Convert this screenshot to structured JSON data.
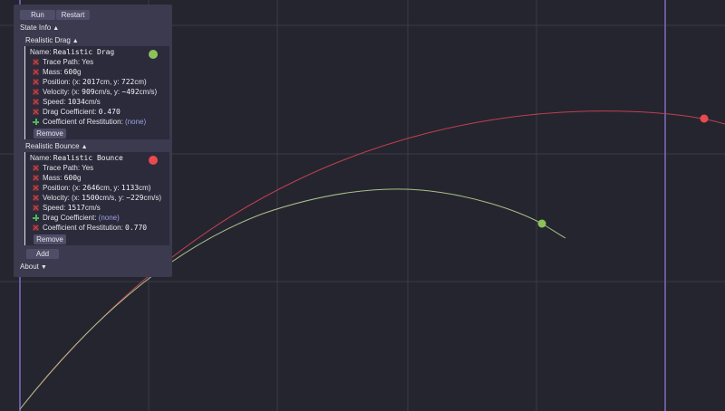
{
  "controls": {
    "run_label": "Run",
    "restart_label": "Restart",
    "add_label": "Add"
  },
  "state_info": {
    "label": "State Info",
    "toggle": "▲"
  },
  "about": {
    "label": "About",
    "toggle": "▼"
  },
  "bodies": [
    {
      "header": "Realistic Drag",
      "toggle": "▲",
      "color": "#e84a4f",
      "name_label": "Name:",
      "name": "Realistic Drag",
      "trace_path": "Trace Path: Yes",
      "mass_label": "Mass:",
      "mass": "600",
      "mass_unit": "g",
      "pos_label": "Position: (x:",
      "pos_x": "2017",
      "pos_mid": "cm, y:",
      "pos_y": "722",
      "pos_end": "cm)",
      "vel_label": "Velocity: (x:",
      "vel_x": "909",
      "vel_mid": "cm/s, y:",
      "vel_y": "−492",
      "vel_end": "cm/s)",
      "speed_label": "Speed:",
      "speed": "1034",
      "speed_unit": "cm/s",
      "drag_label": "Drag Coefficient:",
      "drag": "0.470",
      "rest_label": "Coefficient of Restitution:",
      "rest": "(none)",
      "remove_label": "Remove"
    },
    {
      "header": "Realistic Bounce",
      "toggle": "▲",
      "color": "#8cc25a",
      "name_label": "Name:",
      "name": "Realistic Bounce",
      "trace_path": "Trace Path: Yes",
      "mass_label": "Mass:",
      "mass": "600",
      "mass_unit": "g",
      "pos_label": "Position: (x:",
      "pos_x": "2646",
      "pos_mid": "cm, y:",
      "pos_y": "1133",
      "pos_end": "cm)",
      "vel_label": "Velocity: (x:",
      "vel_x": "1500",
      "vel_mid": "cm/s, y:",
      "vel_y": "−229",
      "vel_end": "cm/s)",
      "speed_label": "Speed:",
      "speed": "1517",
      "speed_unit": "cm/s",
      "drag_label": "Drag Coefficient:",
      "drag": "(none)",
      "rest_label": "Coefficient of Restitution:",
      "rest": "0.770",
      "remove_label": "Remove"
    }
  ],
  "colors": {
    "background": "#25252f",
    "grid": "#3a3a4a",
    "axis": "#6a5aa0",
    "drag_trace": "#c04050",
    "bounce_trace": "#a8c08a",
    "drag_ball": "#e84a4f",
    "bounce_ball": "#8cc25a"
  }
}
